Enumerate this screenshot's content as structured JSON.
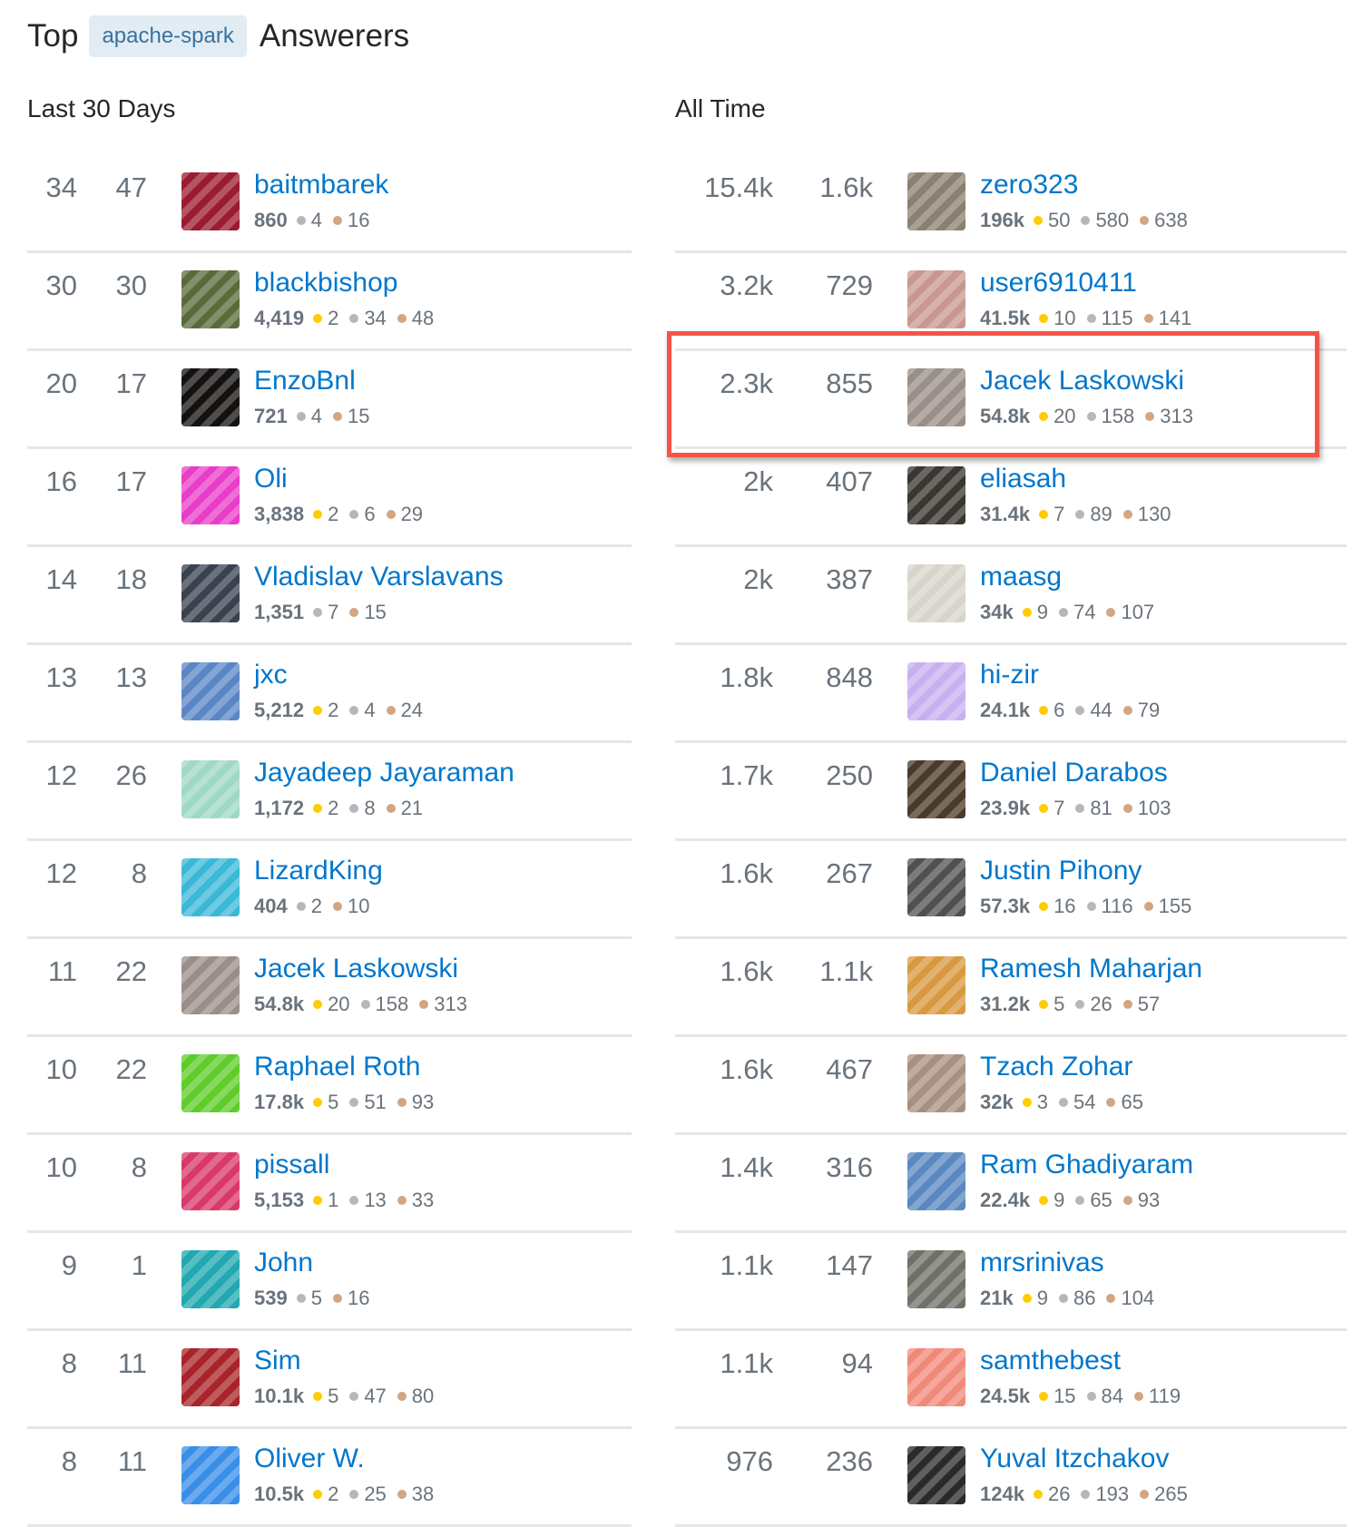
{
  "header": {
    "prefix": "Top",
    "tag": "apache-spark",
    "suffix": "Answerers"
  },
  "colors": {
    "gold": "#ffcc01",
    "silver": "#b4b8bc",
    "bronze": "#d1a684",
    "link": "#0077cc",
    "highlight": "#f25548"
  },
  "last30": {
    "title": "Last 30 Days",
    "rows": [
      {
        "a": "34",
        "b": "47",
        "name": "baitmbarek",
        "rep": "860",
        "gold": null,
        "silver": "4",
        "bronze": "16",
        "avatar": "#9b1b30"
      },
      {
        "a": "30",
        "b": "30",
        "name": "blackbishop",
        "rep": "4,419",
        "gold": "2",
        "silver": "34",
        "bronze": "48",
        "avatar": "#5a6b3a"
      },
      {
        "a": "20",
        "b": "17",
        "name": "EnzoBnl",
        "rep": "721",
        "gold": null,
        "silver": "4",
        "bronze": "15",
        "avatar": "#141210"
      },
      {
        "a": "16",
        "b": "17",
        "name": "Oli",
        "rep": "3,838",
        "gold": "2",
        "silver": "6",
        "bronze": "29",
        "avatar": "#e83dc8"
      },
      {
        "a": "14",
        "b": "18",
        "name": "Vladislav Varslavans",
        "rep": "1,351",
        "gold": null,
        "silver": "7",
        "bronze": "15",
        "avatar": "#3a4250"
      },
      {
        "a": "13",
        "b": "13",
        "name": "jxc",
        "rep": "5,212",
        "gold": "2",
        "silver": "4",
        "bronze": "24",
        "avatar": "#5b86c4"
      },
      {
        "a": "12",
        "b": "26",
        "name": "Jayadeep Jayaraman",
        "rep": "1,172",
        "gold": "2",
        "silver": "8",
        "bronze": "21",
        "avatar": "#9fd8c4"
      },
      {
        "a": "12",
        "b": "8",
        "name": "LizardKing",
        "rep": "404",
        "gold": null,
        "silver": "2",
        "bronze": "10",
        "avatar": "#3bb8d8"
      },
      {
        "a": "11",
        "b": "22",
        "name": "Jacek Laskowski",
        "rep": "54.8k",
        "gold": "20",
        "silver": "158",
        "bronze": "313",
        "avatar": "#9a8f88"
      },
      {
        "a": "10",
        "b": "22",
        "name": "Raphael Roth",
        "rep": "17.8k",
        "gold": "5",
        "silver": "51",
        "bronze": "93",
        "avatar": "#5fcc2a"
      },
      {
        "a": "10",
        "b": "8",
        "name": "pissall",
        "rep": "5,153",
        "gold": "1",
        "silver": "13",
        "bronze": "33",
        "avatar": "#d8386a"
      },
      {
        "a": "9",
        "b": "1",
        "name": "John",
        "rep": "539",
        "gold": null,
        "silver": "5",
        "bronze": "16",
        "avatar": "#22a8b0"
      },
      {
        "a": "8",
        "b": "11",
        "name": "Sim",
        "rep": "10.1k",
        "gold": "5",
        "silver": "47",
        "bronze": "80",
        "avatar": "#a8242a"
      },
      {
        "a": "8",
        "b": "11",
        "name": "Oliver W.",
        "rep": "10.5k",
        "gold": "2",
        "silver": "25",
        "bronze": "38",
        "avatar": "#3a8ee8"
      }
    ]
  },
  "alltime": {
    "title": "All Time",
    "rows": [
      {
        "a": "15.4k",
        "b": "1.6k",
        "name": "zero323",
        "rep": "196k",
        "gold": "50",
        "silver": "580",
        "bronze": "638",
        "avatar": "#8a8070"
      },
      {
        "a": "3.2k",
        "b": "729",
        "name": "user6910411",
        "rep": "41.5k",
        "gold": "10",
        "silver": "115",
        "bronze": "141",
        "avatar": "#c89890"
      },
      {
        "a": "2.3k",
        "b": "855",
        "name": "Jacek Laskowski",
        "rep": "54.8k",
        "gold": "20",
        "silver": "158",
        "bronze": "313",
        "avatar": "#9a8f88"
      },
      {
        "a": "2k",
        "b": "407",
        "name": "eliasah",
        "rep": "31.4k",
        "gold": "7",
        "silver": "89",
        "bronze": "130",
        "avatar": "#3a3630"
      },
      {
        "a": "2k",
        "b": "387",
        "name": "maasg",
        "rep": "34k",
        "gold": "9",
        "silver": "74",
        "bronze": "107",
        "avatar": "#d8d4cc"
      },
      {
        "a": "1.8k",
        "b": "848",
        "name": "hi-zir",
        "rep": "24.1k",
        "gold": "6",
        "silver": "44",
        "bronze": "79",
        "avatar": "#c8b0f0"
      },
      {
        "a": "1.7k",
        "b": "250",
        "name": "Daniel Darabos",
        "rep": "23.9k",
        "gold": "7",
        "silver": "81",
        "bronze": "103",
        "avatar": "#4a3a2a"
      },
      {
        "a": "1.6k",
        "b": "267",
        "name": "Justin Pihony",
        "rep": "57.3k",
        "gold": "16",
        "silver": "116",
        "bronze": "155",
        "avatar": "#505050"
      },
      {
        "a": "1.6k",
        "b": "1.1k",
        "name": "Ramesh Maharjan",
        "rep": "31.2k",
        "gold": "5",
        "silver": "26",
        "bronze": "57",
        "avatar": "#d89a40"
      },
      {
        "a": "1.6k",
        "b": "467",
        "name": "Tzach Zohar",
        "rep": "32k",
        "gold": "3",
        "silver": "54",
        "bronze": "65",
        "avatar": "#a89080"
      },
      {
        "a": "1.4k",
        "b": "316",
        "name": "Ram Ghadiyaram",
        "rep": "22.4k",
        "gold": "9",
        "silver": "65",
        "bronze": "93",
        "avatar": "#5a88c0"
      },
      {
        "a": "1.1k",
        "b": "147",
        "name": "mrsrinivas",
        "rep": "21k",
        "gold": "9",
        "silver": "86",
        "bronze": "104",
        "avatar": "#707068"
      },
      {
        "a": "1.1k",
        "b": "94",
        "name": "samthebest",
        "rep": "24.5k",
        "gold": "15",
        "silver": "84",
        "bronze": "119",
        "avatar": "#f08a78"
      },
      {
        "a": "976",
        "b": "236",
        "name": "Yuval Itzchakov",
        "rep": "124k",
        "gold": "26",
        "silver": "193",
        "bronze": "265",
        "avatar": "#2a2a2a"
      }
    ]
  }
}
